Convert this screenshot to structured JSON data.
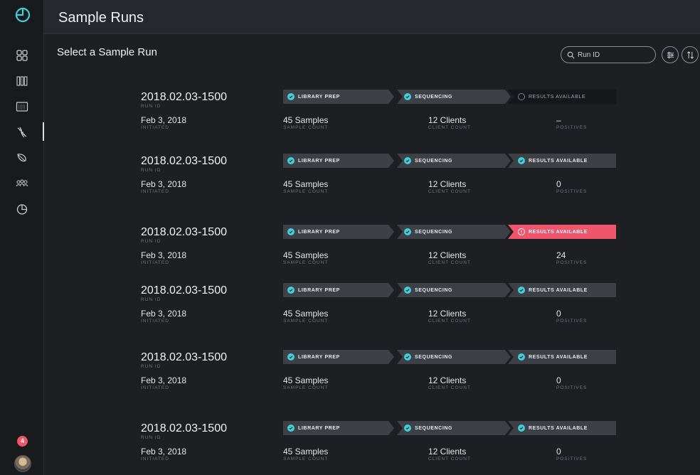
{
  "app": {
    "title": "Sample Runs",
    "accent": "#3fd0dc",
    "alert_color": "#f0566b"
  },
  "sidebar": {
    "logo_icon": "pie-logo-icon",
    "items": [
      {
        "name": "dashboard",
        "icon": "grid-icon"
      },
      {
        "name": "plates",
        "icon": "columns-icon"
      },
      {
        "name": "sequencer",
        "icon": "calendar-grid-icon"
      },
      {
        "name": "sample-runs",
        "icon": "dna-icon",
        "active": true
      },
      {
        "name": "specimens",
        "icon": "leaf-icon"
      },
      {
        "name": "clients",
        "icon": "people-icon"
      },
      {
        "name": "reports",
        "icon": "pie-chart-icon"
      }
    ],
    "notification_count": "4"
  },
  "subheader": {
    "title": "Select a Sample Run"
  },
  "search": {
    "placeholder": "Run ID"
  },
  "labels": {
    "run_id": "RUN ID",
    "initiated": "INITIATED",
    "sample_count": "SAMPLE COUNT",
    "client_count": "CLIENT COUNT",
    "positives": "POSITIVES",
    "stage_library": "LIBRARY PREP",
    "stage_sequencing": "SEQUENCING",
    "stage_results": "RESULTS AVAILABLE"
  },
  "runs": [
    {
      "run_id": "2018.02.03-1500",
      "initiated": "Feb 3, 2018",
      "samples": "45 Samples",
      "clients": "12 Clients",
      "positives": "–",
      "results_state": "pending"
    },
    {
      "run_id": "2018.02.03-1500",
      "initiated": "Feb 3, 2018",
      "samples": "45 Samples",
      "clients": "12 Clients",
      "positives": "0",
      "results_state": "done"
    },
    {
      "run_id": "2018.02.03-1500",
      "initiated": "Feb 3, 2018",
      "samples": "45 Samples",
      "clients": "12 Clients",
      "positives": "24",
      "results_state": "alert"
    },
    {
      "run_id": "2018.02.03-1500",
      "initiated": "Feb 3, 2018",
      "samples": "45 Samples",
      "clients": "12 Clients",
      "positives": "0",
      "results_state": "done"
    },
    {
      "run_id": "2018.02.03-1500",
      "initiated": "Feb 3, 2018",
      "samples": "45 Samples",
      "clients": "12 Clients",
      "positives": "0",
      "results_state": "done"
    },
    {
      "run_id": "2018.02.03-1500",
      "initiated": "Feb 3, 2018",
      "samples": "45 Samples",
      "clients": "12 Clients",
      "positives": "0",
      "results_state": "done"
    }
  ]
}
